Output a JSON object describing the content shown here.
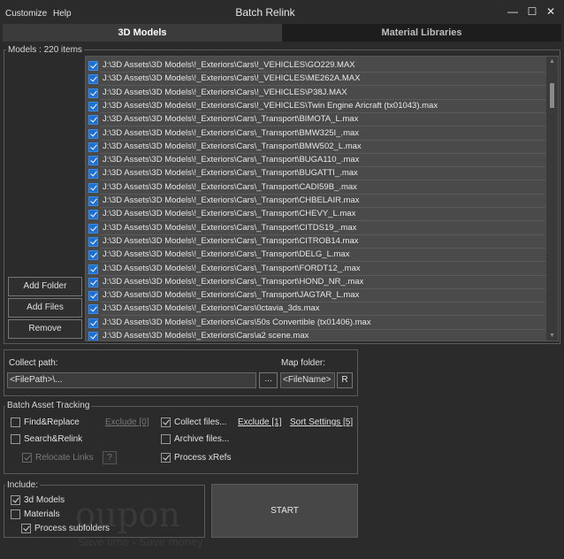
{
  "menu": [
    "Customize",
    "Help"
  ],
  "window": {
    "title": "Batch Relink",
    "minimize": "—",
    "maximize": "☐",
    "close": "✕"
  },
  "tabs": [
    {
      "label": "3D Models",
      "active": true
    },
    {
      "label": "Material Libraries",
      "active": false
    }
  ],
  "models": {
    "legend": "Models : 220 items",
    "buttons": {
      "add_folder": "Add Folder",
      "add_files": "Add Files",
      "remove": "Remove"
    },
    "items": [
      "J:\\3D Assets\\3D Models\\!_Exteriors\\Cars\\!_VEHICLES\\GO229.MAX",
      "J:\\3D Assets\\3D Models\\!_Exteriors\\Cars\\!_VEHICLES\\ME262A.MAX",
      "J:\\3D Assets\\3D Models\\!_Exteriors\\Cars\\!_VEHICLES\\P38J.MAX",
      "J:\\3D Assets\\3D Models\\!_Exteriors\\Cars\\!_VEHICLES\\Twin Engine Aricraft (tx01043).max",
      "J:\\3D Assets\\3D Models\\!_Exteriors\\Cars\\_Transport\\BIMOTA_L.max",
      "J:\\3D Assets\\3D Models\\!_Exteriors\\Cars\\_Transport\\BMW325I_.max",
      "J:\\3D Assets\\3D Models\\!_Exteriors\\Cars\\_Transport\\BMW502_L.max",
      "J:\\3D Assets\\3D Models\\!_Exteriors\\Cars\\_Transport\\BUGA110_.max",
      "J:\\3D Assets\\3D Models\\!_Exteriors\\Cars\\_Transport\\BUGATTI_.max",
      "J:\\3D Assets\\3D Models\\!_Exteriors\\Cars\\_Transport\\CADI59B_.max",
      "J:\\3D Assets\\3D Models\\!_Exteriors\\Cars\\_Transport\\CHBELAIR.max",
      "J:\\3D Assets\\3D Models\\!_Exteriors\\Cars\\_Transport\\CHEVY_L.max",
      "J:\\3D Assets\\3D Models\\!_Exteriors\\Cars\\_Transport\\CITDS19_.max",
      "J:\\3D Assets\\3D Models\\!_Exteriors\\Cars\\_Transport\\CITROB14.max",
      "J:\\3D Assets\\3D Models\\!_Exteriors\\Cars\\_Transport\\DELG_L.max",
      "J:\\3D Assets\\3D Models\\!_Exteriors\\Cars\\_Transport\\FORDT12_.max",
      "J:\\3D Assets\\3D Models\\!_Exteriors\\Cars\\_Transport\\HOND_NR_.max",
      "J:\\3D Assets\\3D Models\\!_Exteriors\\Cars\\_Transport\\JAGTAR_L.max",
      "J:\\3D Assets\\3D Models\\!_Exteriors\\Cars\\0ctavia_3ds.max",
      "J:\\3D Assets\\3D Models\\!_Exteriors\\Cars\\50s Convertible (tx01406).max",
      "J:\\3D Assets\\3D Models\\!_Exteriors\\Cars\\a2 scene.max"
    ]
  },
  "paths": {
    "collect_label": "Collect path:",
    "collect_value": "<FilePath>\\...",
    "browse": "...",
    "map_label": "Map folder:",
    "map_value": "<FileName>",
    "r_button": "R"
  },
  "tracking": {
    "legend": "Batch Asset Tracking",
    "find_replace": {
      "label": "Find&Replace",
      "checked": false
    },
    "exclude_left": "Exclude [0]",
    "search_relink": {
      "label": "Search&Relink",
      "checked": false
    },
    "relocate_links": {
      "label": "Relocate Links",
      "checked": true
    },
    "help": "?",
    "collect_files": {
      "label": "Collect files...",
      "checked": true
    },
    "exclude_right": "Exclude [1]",
    "sort_settings": "Sort Settings [5]",
    "archive_files": {
      "label": "Archive files...",
      "checked": false
    },
    "process_xrefs": {
      "label": "Process xRefs",
      "checked": true
    }
  },
  "include": {
    "legend": "Include:",
    "models_3d": {
      "label": "3d Models",
      "checked": true
    },
    "materials": {
      "label": "Materials",
      "checked": false
    },
    "subfolders": {
      "label": "Process subfolders",
      "checked": true
    }
  },
  "start_label": "START",
  "watermark": {
    "big": "oupon",
    "small": "Save time - Save money"
  }
}
